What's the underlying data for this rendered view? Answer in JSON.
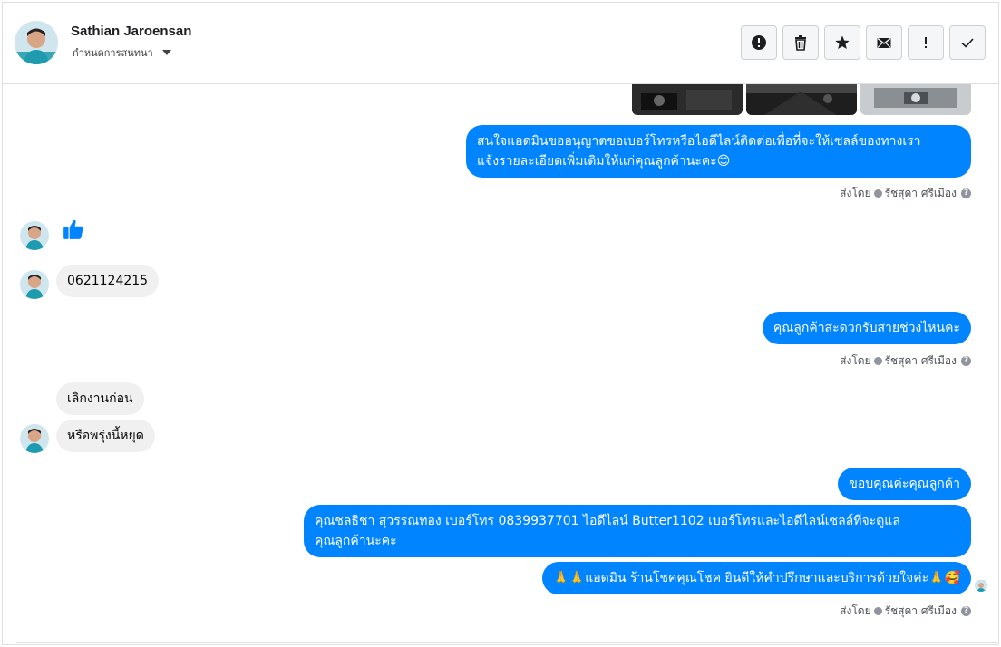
{
  "header": {
    "name": "Sathian Jaroensan",
    "assign_label": "กำหนดการสนทนา",
    "actions": [
      {
        "icon": "alert-circle-icon"
      },
      {
        "icon": "trash-icon"
      },
      {
        "icon": "star-icon"
      },
      {
        "icon": "envelope-icon"
      },
      {
        "icon": "exclamation-icon",
        "label": "!"
      },
      {
        "icon": "check-icon"
      }
    ]
  },
  "messages": {
    "m1": "สนใจแอดมินขออนุญาตขอเบอร์โทรหรือไอดีไลน์ติดต่อเพื่อที่จะให้เซลล์ของทางเรา",
    "m1b": "แจ้งรายละเอียดเพิ่มเติมให้แก่คุณลูกค้านะคะ😊",
    "in1": "0621124215",
    "m2": "คุณลูกค้าสะดวกรับสายช่วงไหนคะ",
    "in2": "เลิกงานก่อน",
    "in3": "หรือพรุ่งนี้หยุด",
    "m3": "ขอบคุณค่ะคุณลูกค้า",
    "m4": "คุณชลธิชา สุวรรณทอง   เบอร์โทร 0839937701  ไอดีไลน์ Butter1102   เบอร์โทรและไอดีไลน์เซลล์ที่จะดูแล",
    "m4b": "คุณลูกค้านะคะ",
    "m5": "🙏🙏แอดมิน ร้านโชคคุณโชค ยินดีให้คำปรึกษาและบริการด้วยใจค่ะ🙏🥰"
  },
  "sent_by": {
    "prefix": "ส่งโดย",
    "agent": "รัชสุดา ศรีเมือง",
    "help": "?"
  },
  "colors": {
    "outgoing": "#0084ff",
    "incoming": "#f1f0f0",
    "like": "#0084ff"
  }
}
